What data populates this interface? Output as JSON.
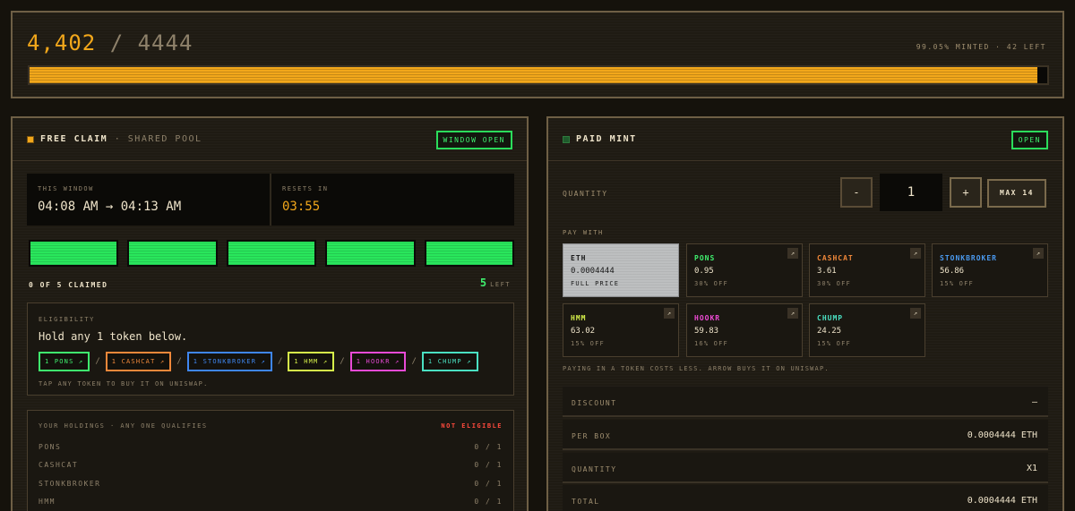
{
  "progress": {
    "minted": "4,402",
    "slash": "/",
    "total": "4444",
    "status": "99.05% MINTED · 42 LEFT",
    "fill_percent": 99.05
  },
  "free_claim": {
    "title": "FREE CLAIM",
    "subtitle": "· SHARED POOL",
    "badge": "WINDOW OPEN",
    "window_label": "THIS WINDOW",
    "window_value": "04:08 AM → 04:13 AM",
    "resets_label": "RESETS IN",
    "resets_value": "03:55",
    "claimed_text": "0 OF 5 CLAIMED",
    "left_count": "5",
    "left_label": "LEFT",
    "slots_total": 5,
    "eligibility": {
      "label": "ELIGIBILITY",
      "text": "Hold any 1 token below.",
      "tokens": [
        {
          "label": "1 PONS ↗",
          "color": "#3ff06e"
        },
        {
          "label": "1 CASHCAT ↗",
          "color": "#f0883a"
        },
        {
          "label": "1 STONKBROKER ↗",
          "color": "#3f86f0"
        },
        {
          "label": "1 HMM ↗",
          "color": "#d6f04a"
        },
        {
          "label": "1 HOOKR ↗",
          "color": "#e84ad6"
        },
        {
          "label": "1 CHUMP ↗",
          "color": "#4ae0c2"
        }
      ],
      "hint": "TAP ANY TOKEN TO BUY IT ON UNISWAP."
    },
    "holdings": {
      "label": "YOUR HOLDINGS · ANY ONE QUALIFIES",
      "status": "NOT ELIGIBLE",
      "rows": [
        {
          "name": "PONS",
          "value": "0 / 1"
        },
        {
          "name": "CASHCAT",
          "value": "0 / 1"
        },
        {
          "name": "STONKBROKER",
          "value": "0 / 1"
        },
        {
          "name": "HMM",
          "value": "0 / 1"
        }
      ]
    }
  },
  "paid_mint": {
    "title": "PAID MINT",
    "badge": "OPEN",
    "quantity_label": "QUANTITY",
    "minus": "-",
    "quantity": "1",
    "plus": "+",
    "max": "MAX 14",
    "pay_with_label": "PAY WITH",
    "pay_options": [
      {
        "name": "ETH",
        "value": "0.0004444",
        "discount": "FULL PRICE",
        "color": "#1a1a1a",
        "selected": true
      },
      {
        "name": "PONS",
        "value": "0.95",
        "discount": "30% OFF",
        "color": "#3ff06e",
        "arrow": "↗"
      },
      {
        "name": "CASHCAT",
        "value": "3.61",
        "discount": "30% OFF",
        "color": "#f0883a",
        "arrow": "↗"
      },
      {
        "name": "STONKBROKER",
        "value": "56.86",
        "discount": "15% OFF",
        "color": "#4a9af0",
        "arrow": "↗"
      },
      {
        "name": "HMM",
        "value": "63.02",
        "discount": "15% OFF",
        "color": "#d6f04a",
        "arrow": "↗"
      },
      {
        "name": "HOOKR",
        "value": "59.83",
        "discount": "16% OFF",
        "color": "#f04ad6",
        "arrow": "↗"
      },
      {
        "name": "CHUMP",
        "value": "24.25",
        "discount": "15% OFF",
        "color": "#4ae0c2",
        "arrow": "↗"
      }
    ],
    "pay_note": "PAYING IN A TOKEN COSTS LESS. ARROW BUYS IT ON UNISWAP.",
    "summary": [
      {
        "key": "DISCOUNT",
        "value": "–"
      },
      {
        "key": "PER BOX",
        "value": "0.0004444 ETH"
      },
      {
        "key": "QUANTITY",
        "value": "X1"
      },
      {
        "key": "TOTAL",
        "value": "0.0004444 ETH"
      }
    ]
  },
  "colors": {
    "accent_orange": "#f2a71b",
    "accent_green": "#2bdc5b",
    "danger_red": "#ff4a3d"
  }
}
